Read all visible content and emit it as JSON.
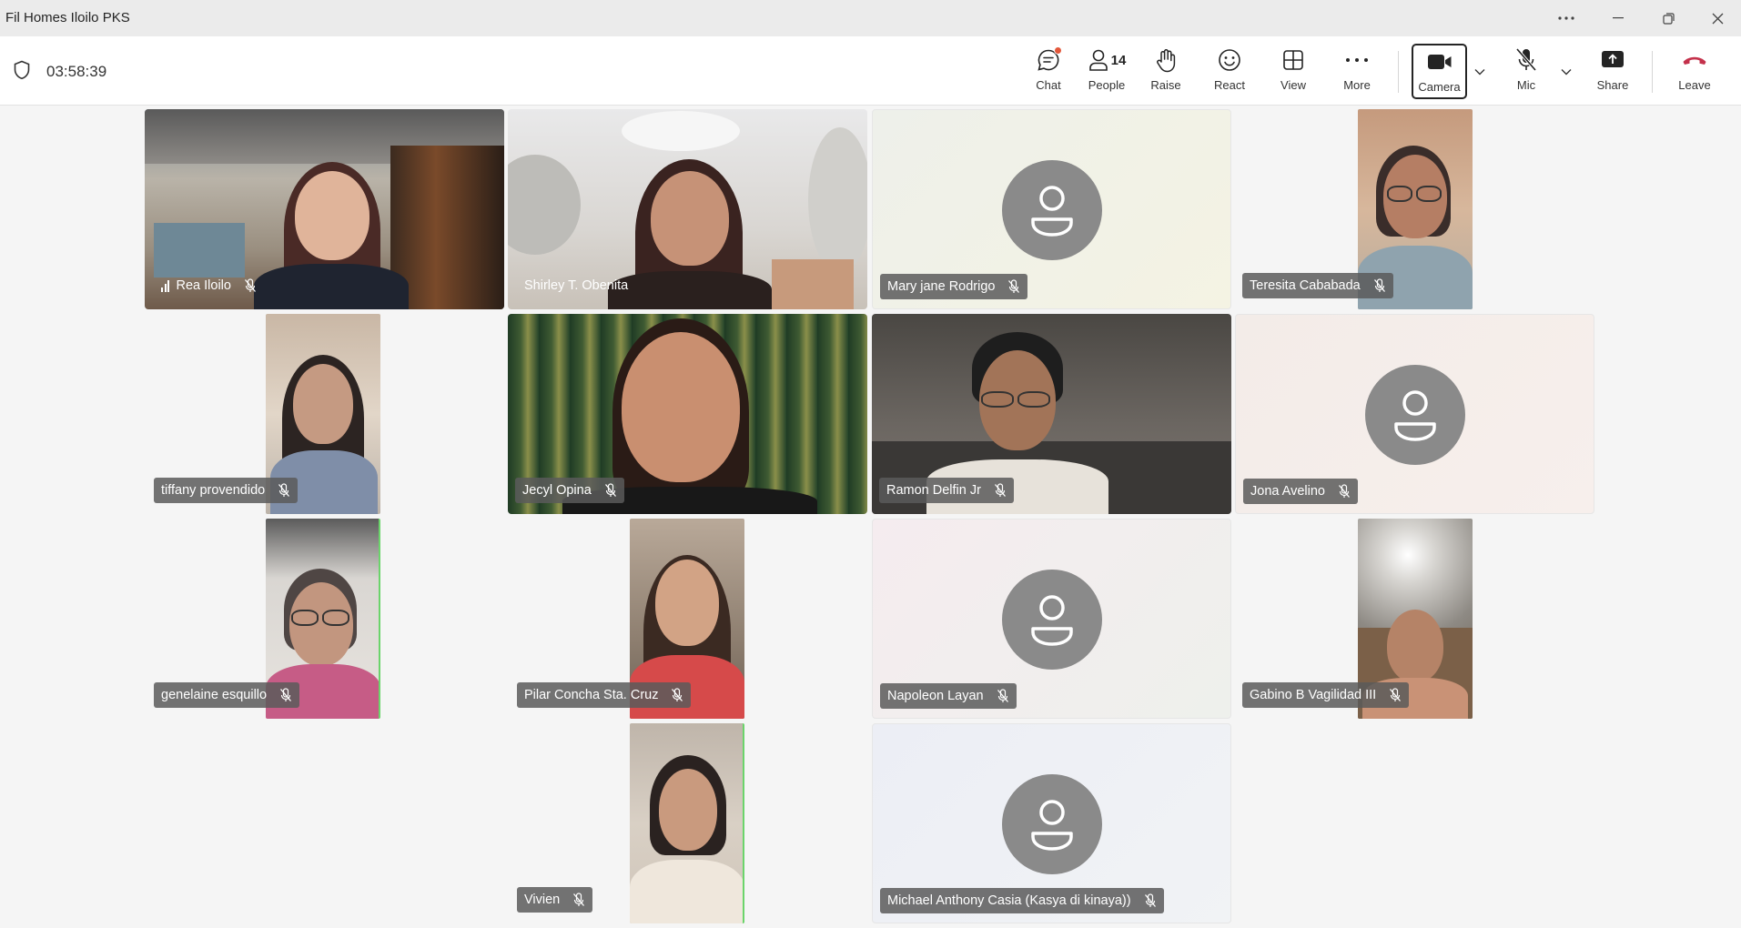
{
  "window": {
    "title": "Fil Homes Iloilo PKS",
    "controls": {
      "more": "more-icon",
      "minimize": "minimize-icon",
      "restore": "restore-icon",
      "close": "close-icon"
    }
  },
  "meeting": {
    "timer": "03:58:39"
  },
  "toolbar": {
    "chat": "Chat",
    "people": "People",
    "people_count": "14",
    "raise": "Raise",
    "react": "React",
    "view": "View",
    "more": "More",
    "camera": "Camera",
    "mic": "Mic",
    "share": "Share",
    "leave": "Leave"
  },
  "colors": {
    "leave": "#c4314b",
    "notification": "#e3573a",
    "tag_bg": "#5a5a5a",
    "avatar": "#8a8a8a"
  },
  "participants": [
    {
      "name": "Rea Iloilo",
      "video": true,
      "muted": true
    },
    {
      "name": "Shirley T. Obenita",
      "video": true,
      "muted": false
    },
    {
      "name": "Mary jane Rodrigo",
      "video": false,
      "muted": true
    },
    {
      "name": "Teresita Cababada",
      "video": true,
      "muted": true
    },
    {
      "name": "tiffany provendido",
      "video": true,
      "muted": true
    },
    {
      "name": "Jecyl Opina",
      "video": true,
      "muted": true
    },
    {
      "name": "Ramon Delfin Jr",
      "video": true,
      "muted": true
    },
    {
      "name": "Jona Avelino",
      "video": false,
      "muted": true
    },
    {
      "name": "genelaine esquillo",
      "video": true,
      "muted": true
    },
    {
      "name": "Pilar Concha Sta. Cruz",
      "video": true,
      "muted": true
    },
    {
      "name": "Napoleon Layan",
      "video": false,
      "muted": true
    },
    {
      "name": "Gabino B Vagilidad III",
      "video": true,
      "muted": true
    },
    {
      "name": "Vivien",
      "video": true,
      "muted": true
    },
    {
      "name": "Michael Anthony Casia (Kasya di kinaya))",
      "video": false,
      "muted": true
    }
  ]
}
